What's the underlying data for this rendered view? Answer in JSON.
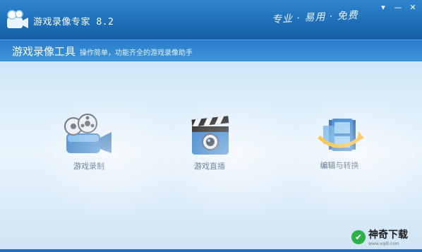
{
  "window": {
    "title": "游戏录像专家 8.2",
    "slogan": "专业 · 易用 · 免费",
    "controls": {
      "menu": "▾",
      "minimize": "—",
      "close": "✕"
    }
  },
  "header": {
    "title": "游戏录像工具",
    "subtitle": "操作简单，功能齐全的游戏录像助手"
  },
  "tools": [
    {
      "label": "游戏录制",
      "icon": "camera-recorder-icon"
    },
    {
      "label": "游戏直播",
      "icon": "clapperboard-icon"
    },
    {
      "label": "编辑与转换",
      "icon": "film-convert-icon"
    }
  ],
  "watermark": {
    "text": "神奇下载",
    "subtext": "www.xqdl.com"
  },
  "colors": {
    "titlebar": "#1e6fb8",
    "accent": "#2b7ecb",
    "background": "#d9ecfa"
  }
}
